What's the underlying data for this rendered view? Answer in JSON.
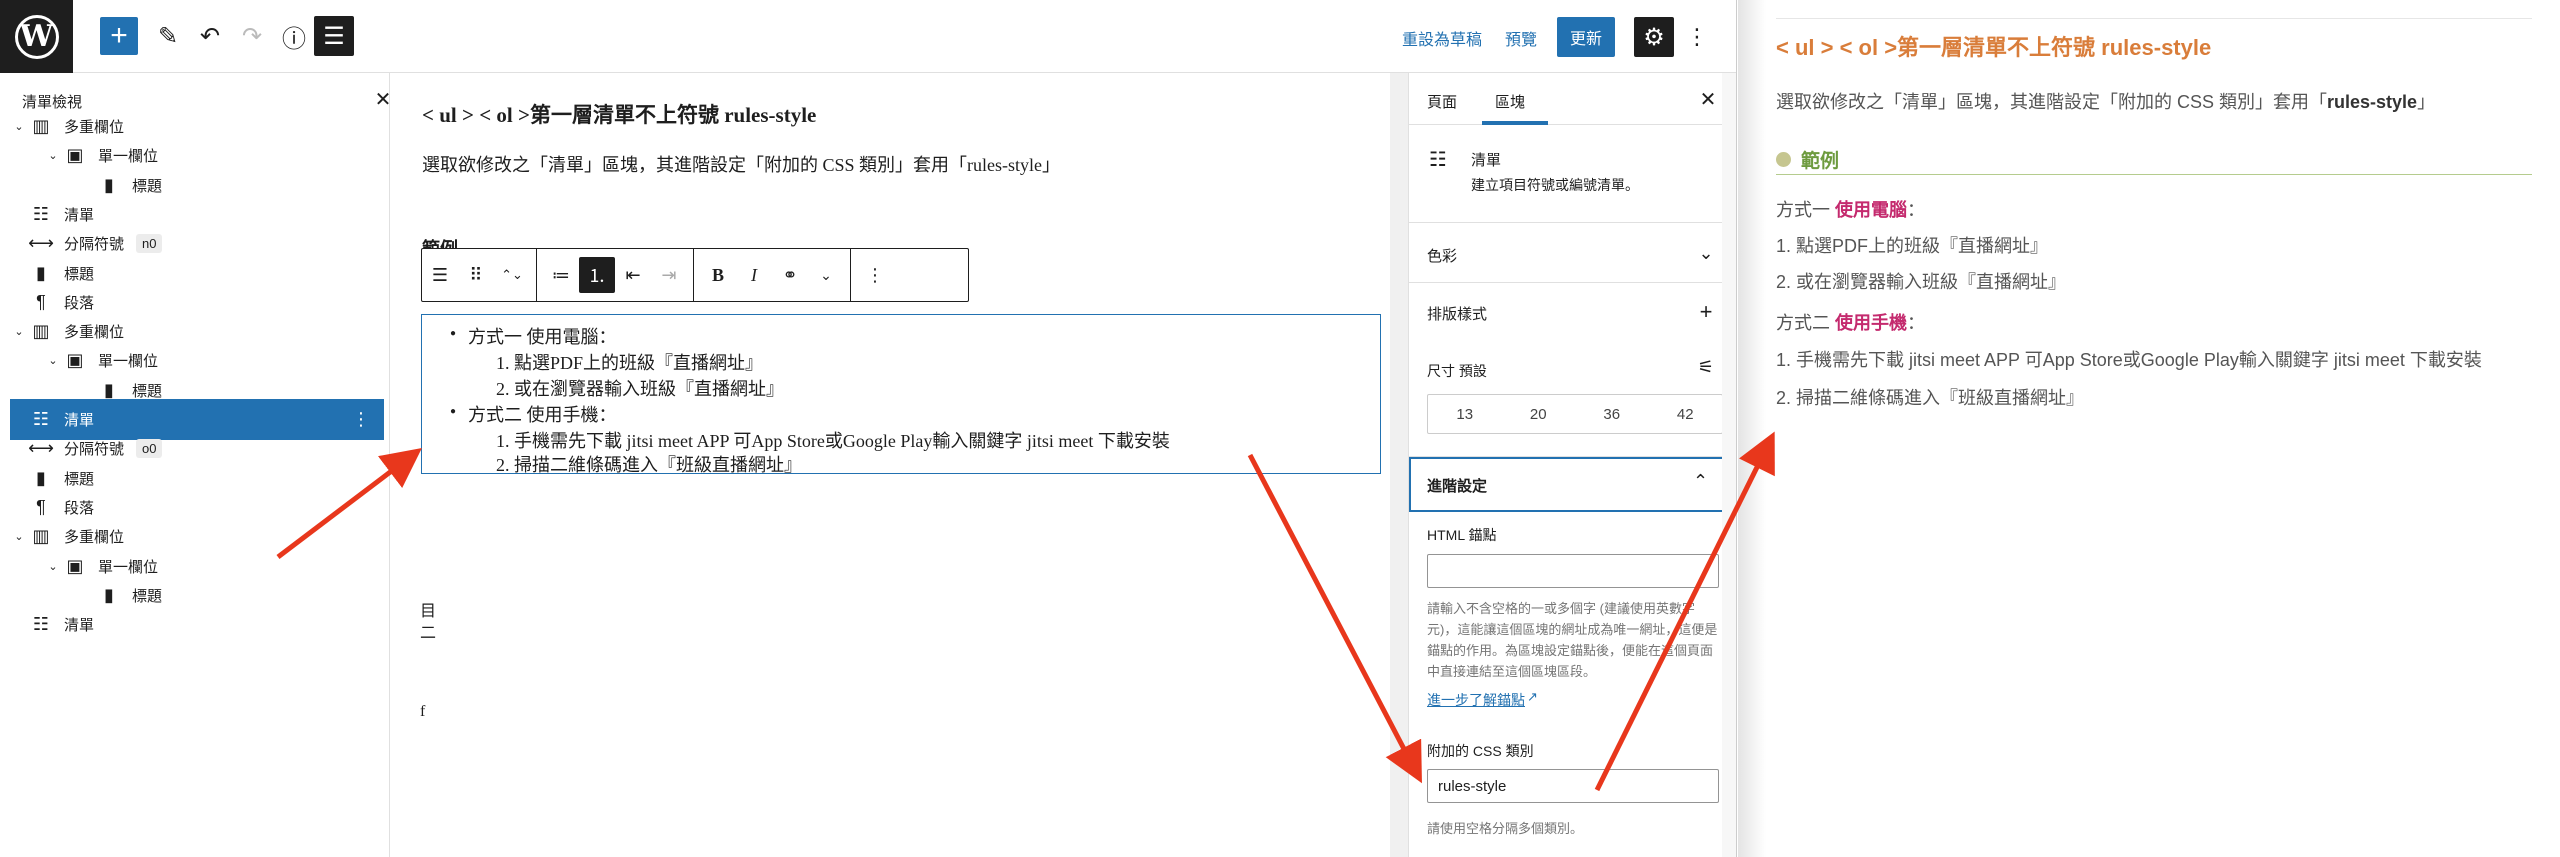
{
  "toolbar": {
    "logo": "W",
    "add_icon": "+",
    "tool_icon": "✎",
    "undo_icon": "↶",
    "redo_icon": "↷",
    "info_icon": "ⓘ",
    "listview_icon": "☰",
    "save_draft": "重設為草稿",
    "preview": "預覽",
    "update": "更新",
    "settings_icon": "⚙",
    "more_icon": "⋮"
  },
  "listview": {
    "title": "清單檢視",
    "close": "✕",
    "items": [
      {
        "chev": "⌄",
        "icon": "▥",
        "label": "多重欄位",
        "badge": ""
      },
      {
        "chev": "⌄",
        "icon": "▣",
        "label": "單一欄位",
        "badge": ""
      },
      {
        "chev": "",
        "icon": "▮",
        "label": "標題",
        "badge": ""
      },
      {
        "chev": "",
        "icon": "☷",
        "label": "清單",
        "badge": ""
      },
      {
        "chev": "",
        "icon": "⟷",
        "label": "分隔符號",
        "badge": "n0"
      },
      {
        "chev": "",
        "icon": "▮",
        "label": "標題",
        "badge": ""
      },
      {
        "chev": "",
        "icon": "¶",
        "label": "段落",
        "badge": ""
      },
      {
        "chev": "⌄",
        "icon": "▥",
        "label": "多重欄位",
        "badge": ""
      },
      {
        "chev": "⌄",
        "icon": "▣",
        "label": "單一欄位",
        "badge": ""
      },
      {
        "chev": "",
        "icon": "▮",
        "label": "標題",
        "badge": ""
      },
      {
        "chev": "",
        "icon": "☷",
        "label": "清單",
        "badge": ""
      },
      {
        "chev": "",
        "icon": "⟷",
        "label": "分隔符號",
        "badge": "o0"
      },
      {
        "chev": "",
        "icon": "▮",
        "label": "標題",
        "badge": ""
      },
      {
        "chev": "",
        "icon": "¶",
        "label": "段落",
        "badge": ""
      },
      {
        "chev": "⌄",
        "icon": "▥",
        "label": "多重欄位",
        "badge": ""
      },
      {
        "chev": "⌄",
        "icon": "▣",
        "label": "單一欄位",
        "badge": ""
      },
      {
        "chev": "",
        "icon": "▮",
        "label": "標題",
        "badge": ""
      },
      {
        "chev": "",
        "icon": "☷",
        "label": "清單",
        "badge": ""
      }
    ],
    "selected_dots": "⋮"
  },
  "canvas": {
    "title": "< ul > < ol >第一層清單不上符號 rules-style",
    "paragraph": "選取欲修改之「清單」區塊，其進階設定「附加的 CSS 類別」套用「rules-style」",
    "heading": "範例",
    "block_toolbar": [
      "☰",
      "⠿",
      "⌃⌄",
      "≔",
      "⒈",
      "⇤",
      "⇥",
      "B",
      "I",
      "⚭",
      "⌄",
      "⋮"
    ],
    "list": [
      "方式一 使用電腦：",
      "1. 點選PDF上的班級『直播網址』",
      "2. 或在瀏覽器輸入班級『直播網址』",
      "方式二 使用手機：",
      "1. 手機需先下載 jitsi meet APP 可App Store或Google Play輸入關鍵字 jitsi meet 下載安裝",
      "2. 掃描二維條碼進入『班級直播網址』"
    ],
    "frag1": "目",
    "frag2": "二",
    "frag3": "f"
  },
  "sidebar": {
    "tab_page": "頁面",
    "tab_block": "區塊",
    "close": "✕",
    "block_icon": "☷",
    "block_name": "清單",
    "block_desc": "建立項目符號或編號清單。",
    "color_title": "色彩",
    "color_ctl": "⌄",
    "typo_title": "排版樣式",
    "typo_ctl": "+",
    "size_label": "尺寸 預設",
    "size_ctl": "⚟",
    "sizes": [
      "13",
      "20",
      "36",
      "42"
    ],
    "adv_title": "進階設定",
    "adv_ctl": "⌃",
    "anchor_label": "HTML 錨點",
    "anchor_value": "",
    "anchor_help": "請輸入不含空格的一或多個字 (建議使用英數字元)，這能讓這個區塊的網址成為唯一網址，這便是錨點的作用。為區塊設定錨點後，便能在這個頁面中直接連結至這個區塊區段。",
    "learn_more": "進一步了解錨點",
    "ext_icon": "↗",
    "css_label": "附加的 CSS 類別",
    "css_value": "rules-style",
    "css_help": "請使用空格分隔多個類別。"
  },
  "preview": {
    "title": "< ul > < ol >第一層清單不上符號 rules-style",
    "lead_prefix": "選取欲修改之「清單」區塊，其進階設定「附加的 CSS 類別」套用「",
    "lead_bold": "rules-style",
    "lead_suffix": "」",
    "heading": "範例",
    "l1_prefix": "方式一 ",
    "l1_em": "使用電腦",
    "l1_suffix": "：",
    "l2": "1. 點選PDF上的班級『直播網址』",
    "l3": "2. 或在瀏覽器輸入班級『直播網址』",
    "l4_prefix": "方式二 ",
    "l4_em": "使用手機",
    "l4_suffix": "：",
    "l5": "1. 手機需先下載 jitsi meet APP 可App Store或Google Play輸入關鍵字 jitsi meet 下載安裝",
    "l6": "2. 掃描二維條碼進入『班級直播網址』"
  },
  "colors": {
    "accent": "#2271b1",
    "arrow": "#e8371c",
    "preview_title": "#d97d3a",
    "preview_heading": "#6e9b3f",
    "preview_em": "#c42a6e"
  }
}
